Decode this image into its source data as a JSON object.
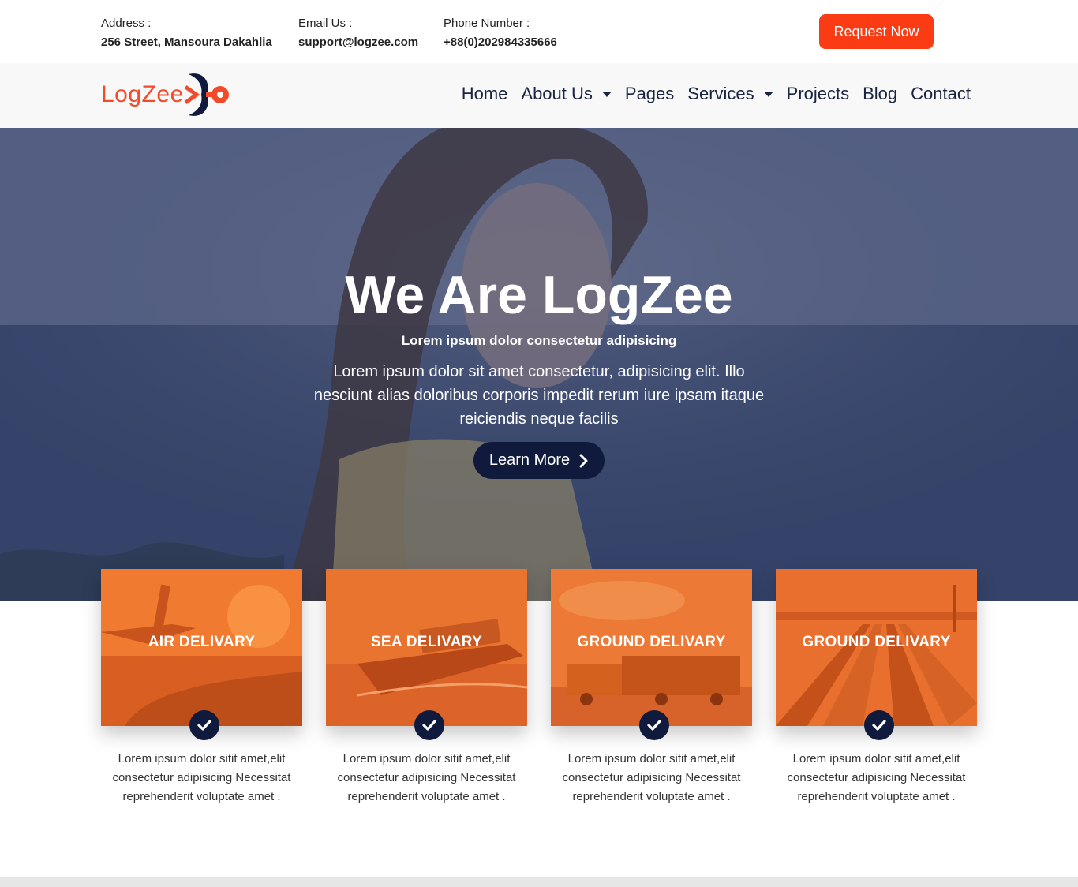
{
  "topbar": {
    "address_label": "Address :",
    "address_value": "256 Street, Mansoura Dakahlia",
    "email_label": "Email Us :",
    "email_value": "support@logzee.com",
    "phone_label": "Phone Number :",
    "phone_value": "+88(0)202984335666",
    "request_button": "Request Now"
  },
  "brand": {
    "logo_text": "LogZee",
    "accent": "#fb3b13",
    "navy": "#0f1a3c"
  },
  "nav": {
    "items": [
      {
        "label": "Home",
        "dropdown": false
      },
      {
        "label": "About Us",
        "dropdown": true
      },
      {
        "label": "Pages",
        "dropdown": false
      },
      {
        "label": "Services",
        "dropdown": true
      },
      {
        "label": "Projects",
        "dropdown": false
      },
      {
        "label": "Blog",
        "dropdown": false
      },
      {
        "label": "Contact",
        "dropdown": false
      }
    ]
  },
  "hero": {
    "title": "We Are LogZee",
    "subtitle": "Lorem ipsum dolor consectetur adipisicing",
    "text": "Lorem ipsum dolor sit amet consectetur, adipisicing elit. Illo nesciunt alias doloribus corporis impedit rerum iure ipsam itaque reiciendis neque facilis",
    "button": "Learn More",
    "button_icon": "chevron-right-icon"
  },
  "services": [
    {
      "title": "AIR DELIVARY",
      "icon": "check-icon",
      "text": "Lorem ipsum dolor sitit amet,elit consectetur adipisicing Necessitat reprehenderit voluptate amet ."
    },
    {
      "title": "SEA DELIVARY",
      "icon": "check-icon",
      "text": "Lorem ipsum dolor sitit amet,elit consectetur adipisicing Necessitat reprehenderit voluptate amet ."
    },
    {
      "title": "GROUND DELIVARY",
      "icon": "check-icon",
      "text": "Lorem ipsum dolor sitit amet,elit consectetur adipisicing Necessitat reprehenderit voluptate amet ."
    },
    {
      "title": "GROUND DELIVARY",
      "icon": "check-icon",
      "text": "Lorem ipsum dolor sitit amet,elit consectetur adipisicing Necessitat reprehenderit voluptate amet ."
    }
  ]
}
